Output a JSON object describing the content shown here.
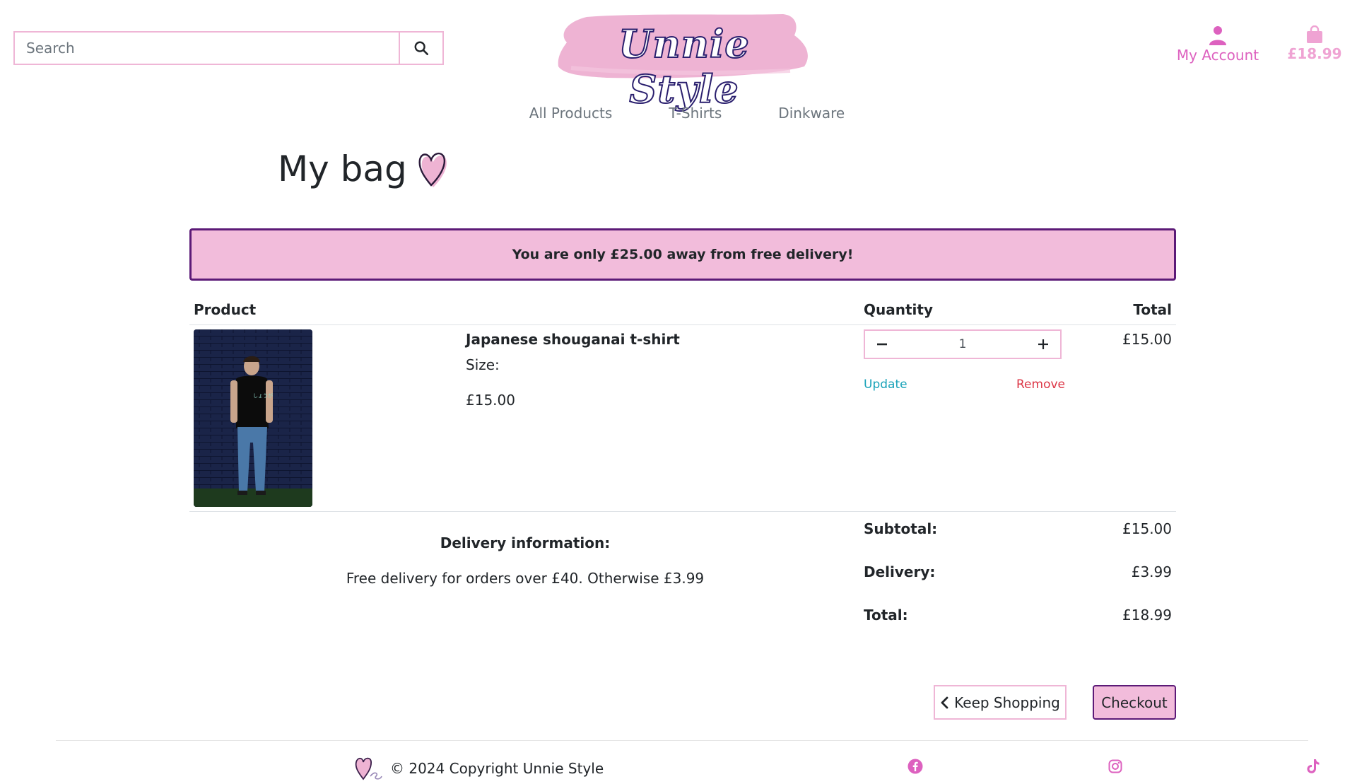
{
  "header": {
    "search": {
      "placeholder": "Search",
      "value": ""
    },
    "logo_text": "Unnie Style",
    "account_label": "My Account",
    "bag_total": "£18.99"
  },
  "nav": {
    "items": [
      "All Products",
      "T-Shirts",
      "Dinkware"
    ]
  },
  "page_title": "My bag",
  "banner_text": "You are only £25.00 away from free delivery!",
  "table": {
    "headers": {
      "product": "Product",
      "quantity": "Quantity",
      "total": "Total"
    },
    "items": [
      {
        "name": "Japanese shouganai t-shirt",
        "size_label": "Size:",
        "price": "£15.00",
        "quantity": "1",
        "update_label": "Update",
        "remove_label": "Remove",
        "total": "£15.00"
      }
    ]
  },
  "delivery_info": {
    "title": "Delivery information:",
    "text": "Free delivery for orders over £40. Otherwise £3.99"
  },
  "summary": {
    "subtotal_label": "Subtotal:",
    "subtotal": "£15.00",
    "delivery_label": "Delivery:",
    "delivery": "£3.99",
    "total_label": "Total:",
    "total": "£18.99"
  },
  "buttons": {
    "keep_shopping": "Keep Shopping",
    "checkout": "Checkout"
  },
  "footer": {
    "copyright": "© 2024 Copyright Unnie Style"
  },
  "colors": {
    "accent_pink": "#f2bcdb",
    "brand_pink": "#dd61bf",
    "border_purple": "#5c1a77",
    "link_teal": "#17a2b8",
    "link_red": "#dc3545"
  },
  "icons": [
    "search-icon",
    "user-icon",
    "shopping-bag-icon",
    "heart-icon",
    "minus-icon",
    "plus-icon",
    "chevron-left-icon",
    "facebook-icon",
    "instagram-icon",
    "tiktok-icon"
  ]
}
